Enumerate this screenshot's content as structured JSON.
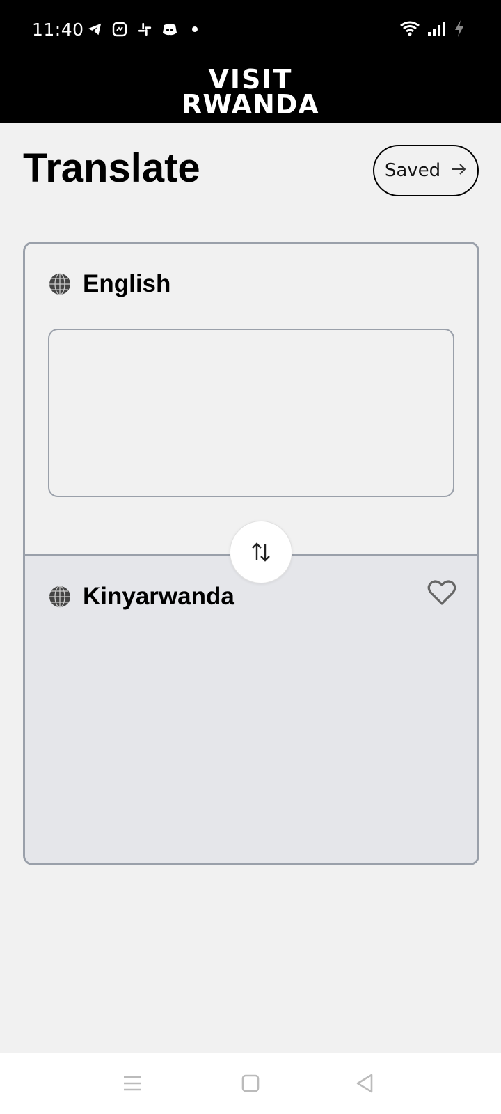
{
  "status_bar": {
    "time": "11:40",
    "left_icons": [
      "telegram-icon",
      "messenger-icon",
      "slack-icon",
      "discord-icon",
      "dot-icon"
    ],
    "right_icons": [
      "wifi-icon",
      "signal-icon",
      "battery-charging-icon"
    ]
  },
  "header": {
    "logo_line1": "VISIT",
    "logo_line2": "RWANDA"
  },
  "page": {
    "title": "Translate",
    "saved_label": "Saved"
  },
  "translator": {
    "source_language": "English",
    "source_text": "",
    "target_language": "Kinyarwanda",
    "target_text": ""
  },
  "colors": {
    "background": "#f1f1f1",
    "header": "#000000",
    "card_border": "#9aa0aa",
    "target_panel": "#e5e6ea"
  }
}
